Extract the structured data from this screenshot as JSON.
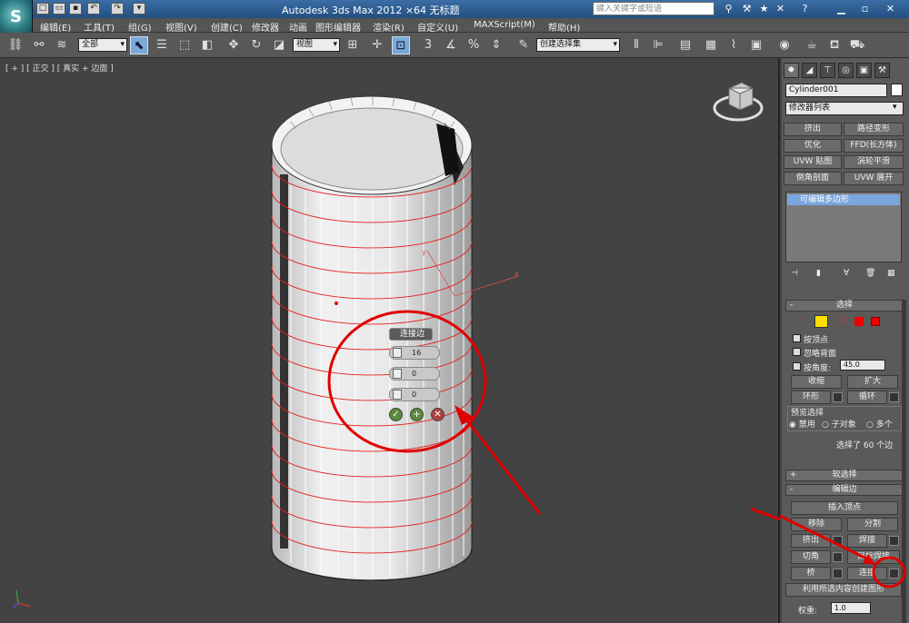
{
  "titlebar": {
    "title": "Autodesk 3ds Max  2012 ×64    无标题",
    "search_placeholder": "键入关键字或短语",
    "help": "?"
  },
  "menu": [
    "编辑(E)",
    "工具(T)",
    "组(G)",
    "视图(V)",
    "创建(C)",
    "修改器",
    "动画",
    "图形编辑器",
    "渲染(R)",
    "自定义(U)",
    "MAXScript(M)",
    "帮助(H)"
  ],
  "toolbar": {
    "selection_filter": "全部",
    "reference_coord": "视图",
    "named_selection": "创建选择集",
    "snap_label": "3",
    "percent_label": "%"
  },
  "viewport": {
    "label": "[ + ] [ 正交 ] [ 真实 + 边面 ]",
    "axis_x": "x",
    "axis_y": "y"
  },
  "caddy": {
    "title": "连接边",
    "segments": "16",
    "pinch": "0",
    "slide": "0",
    "ok": "✓",
    "apply": "+",
    "cancel": "✕"
  },
  "panel": {
    "object_name": "Cylinder001",
    "modifier_list": "修改器列表",
    "modifier_buttons": [
      "挤出",
      "路径变形",
      "优化",
      "FFD(长方体)",
      "UVW 贴图",
      "涡轮平滑",
      "倒角剖面",
      "UVW 展开"
    ],
    "stack_item": "可编辑多边形",
    "selection_header": "选择",
    "by_vertex": "按顶点",
    "ignore_backfacing": "忽略背面",
    "by_angle": "按角度:",
    "angle_value": "45.0",
    "shrink": "收缩",
    "grow": "扩大",
    "ring": "环形",
    "loop": "循环",
    "preview_selection": "预览选择",
    "preview_options": [
      "禁用",
      "子对象",
      "多个"
    ],
    "selected_status": "选择了 60 个边",
    "soft_selection": "软选择",
    "edit_edges": "编辑边",
    "insert_vertex": "插入顶点",
    "remove": "移除",
    "split": "分割",
    "extrude": "挤出",
    "weld": "焊接",
    "chamfer": "切角",
    "target_weld": "目标焊接",
    "bridge": "桥",
    "connect": "连接",
    "create_shape": "利用所选内容创建图形",
    "weight_label": "权重:",
    "weight_value": "1.0"
  },
  "colors": {
    "viewport_bg": "#434343",
    "annotation_red": "#e00000",
    "selection_highlight": "#7aa5dd"
  }
}
